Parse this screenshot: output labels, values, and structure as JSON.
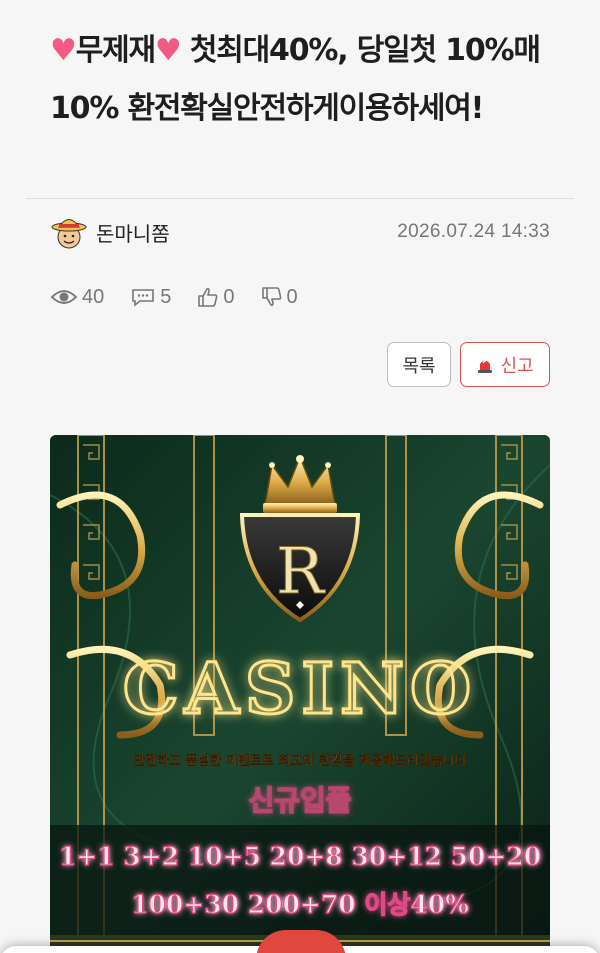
{
  "post": {
    "title_word": "무제재",
    "title_rest": " 첫최대40%, 당일첫 10%매10% 환전확실안전하게이용하세여!",
    "author": "돈마니쫌",
    "date": "2026.07.24 14:33"
  },
  "stats": {
    "views": "40",
    "comments": "5",
    "likes": "0",
    "dislikes": "0"
  },
  "buttons": {
    "list": "목록",
    "report": "신고"
  },
  "banner": {
    "logo_letter": "R",
    "brand": "CASINO",
    "tagline": "안전하고 풍성한 이벤트로 최고의 환경을 제공해드리겠습니다",
    "promo_title": "신규입플",
    "promo_line1": "1+1 3+2 10+5 20+8 30+12 50+20",
    "promo_line2": "100+30 200+70 이상40%"
  },
  "colors": {
    "accent": "#d9534f",
    "heart": "#f25a86",
    "gold": "#e8c46a",
    "banner_bg": "#0f2a1d",
    "fab": "#e0473f"
  },
  "icons": [
    "heart-emoji",
    "avatar-straw-hat",
    "eye-icon",
    "comment-icon",
    "thumbs-up-icon",
    "thumbs-down-icon",
    "siren-icon",
    "crown-icon"
  ]
}
